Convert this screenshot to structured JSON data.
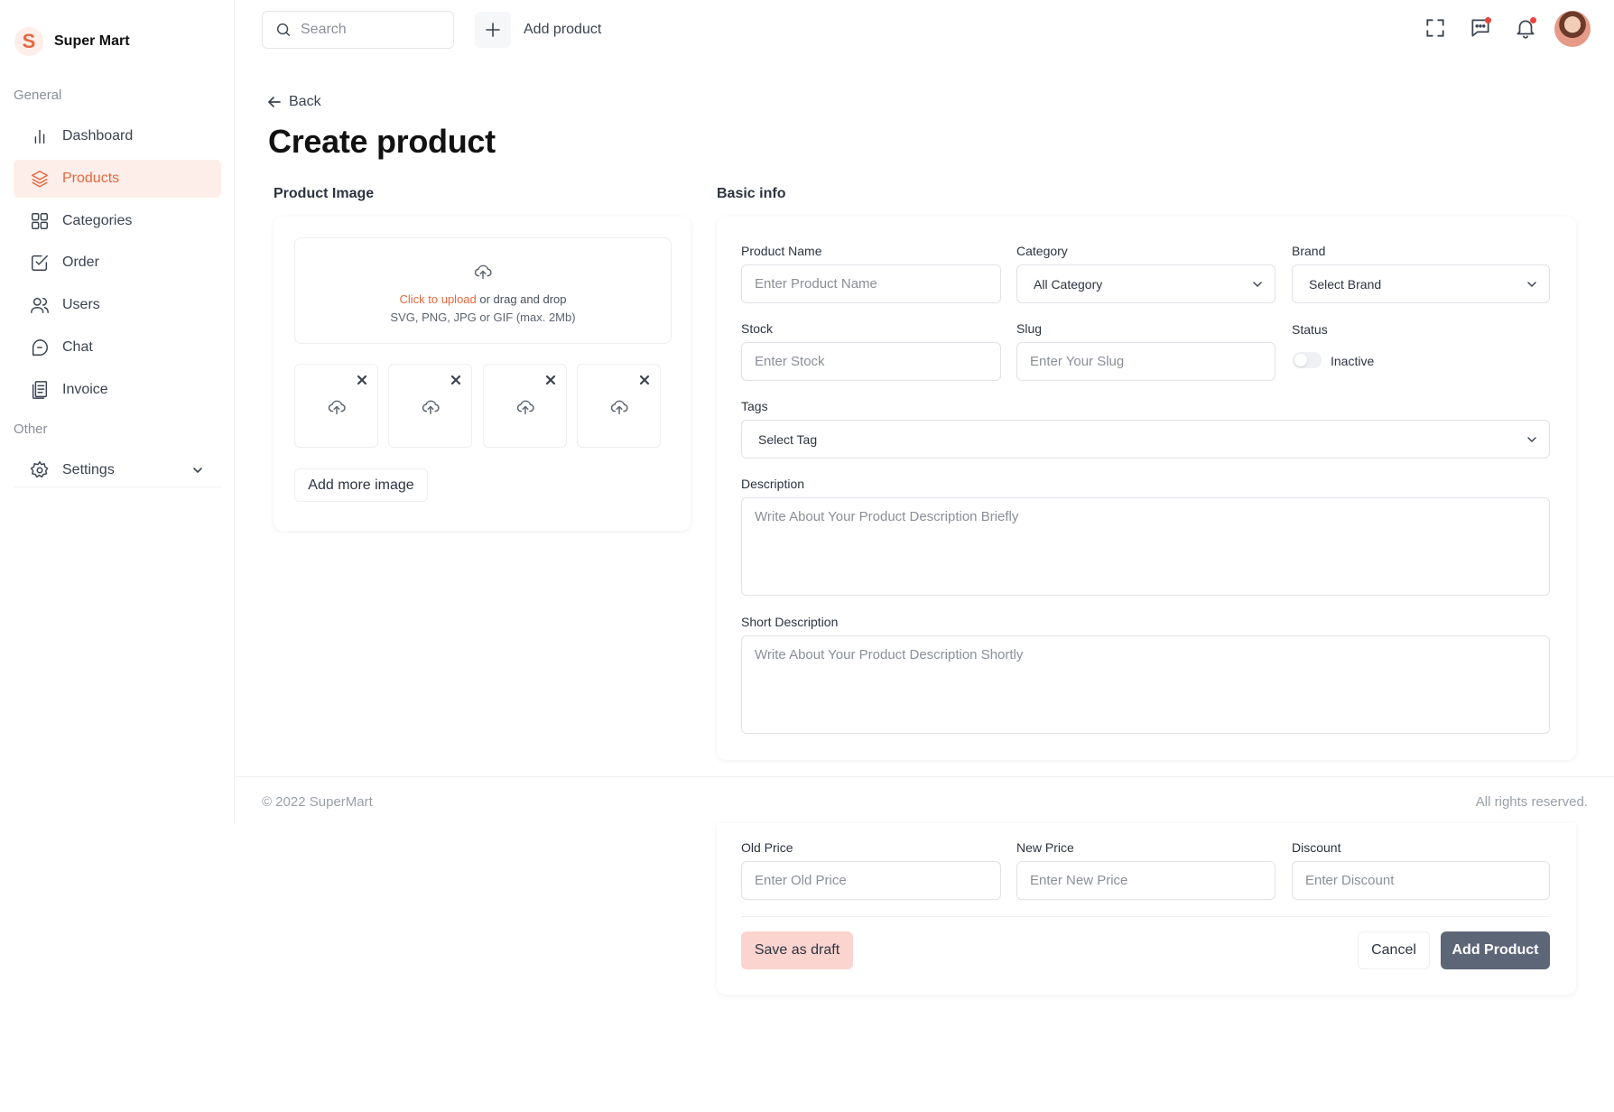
{
  "app": {
    "logo_letter": "S",
    "name": "Super Mart"
  },
  "sidebar": {
    "general_label": "General",
    "other_label": "Other",
    "items": [
      {
        "label": "Dashboard",
        "icon": "bar-chart-icon"
      },
      {
        "label": "Products",
        "icon": "layers-icon",
        "active": true
      },
      {
        "label": "Categories",
        "icon": "grid-icon"
      },
      {
        "label": "Order",
        "icon": "checkbox-icon"
      },
      {
        "label": "Users",
        "icon": "users-icon"
      },
      {
        "label": "Chat",
        "icon": "chat-icon"
      },
      {
        "label": "Invoice",
        "icon": "invoice-icon"
      }
    ],
    "settings_label": "Settings"
  },
  "topbar": {
    "search_placeholder": "Search",
    "add_product_label": "Add product",
    "icons": [
      "fullscreen-icon",
      "message-icon",
      "bell-icon",
      "avatar"
    ]
  },
  "page": {
    "back_label": "Back",
    "title": "Create product",
    "image_section_title": "Product Image",
    "basic_section_title": "Basic info"
  },
  "upload": {
    "click_text": "Click to upload",
    "drag_text": " or drag and drop",
    "formats_text": "SVG, PNG, JPG or GIF (max. 2Mb)",
    "add_more_label": "Add more image",
    "thumb_count": 4
  },
  "form": {
    "product_name": {
      "label": "Product Name",
      "placeholder": "Enter Product Name"
    },
    "category": {
      "label": "Category",
      "value": "All Category"
    },
    "brand": {
      "label": "Brand",
      "value": "Select Brand"
    },
    "stock": {
      "label": "Stock",
      "placeholder": "Enter Stock"
    },
    "slug": {
      "label": "Slug",
      "placeholder": "Enter Your Slug"
    },
    "status": {
      "label": "Status",
      "value": "Inactive",
      "on": false
    },
    "tags": {
      "label": "Tags",
      "value": "Select Tag"
    },
    "description": {
      "label": "Description",
      "placeholder": "Write About Your Product Description Briefly"
    },
    "short_description": {
      "label": "Short Description",
      "placeholder": "Write About Your Product Description Shortly"
    },
    "old_price": {
      "label": "Old Price",
      "placeholder": "Enter Old Price"
    },
    "new_price": {
      "label": "New Price",
      "placeholder": "Enter New Price"
    },
    "discount": {
      "label": "Discount",
      "placeholder": "Enter Discount"
    }
  },
  "actions": {
    "draft_label": "Save as draft",
    "cancel_label": "Cancel",
    "add_label": "Add Product"
  },
  "footer": {
    "copyright": "© 2022 SuperMart",
    "rights": "All rights reserved."
  },
  "colors": {
    "accent": "#e5683f",
    "accent_soft": "#fdeeea",
    "primary_button": "#5d6677",
    "draft_button": "#fcd4cf"
  }
}
